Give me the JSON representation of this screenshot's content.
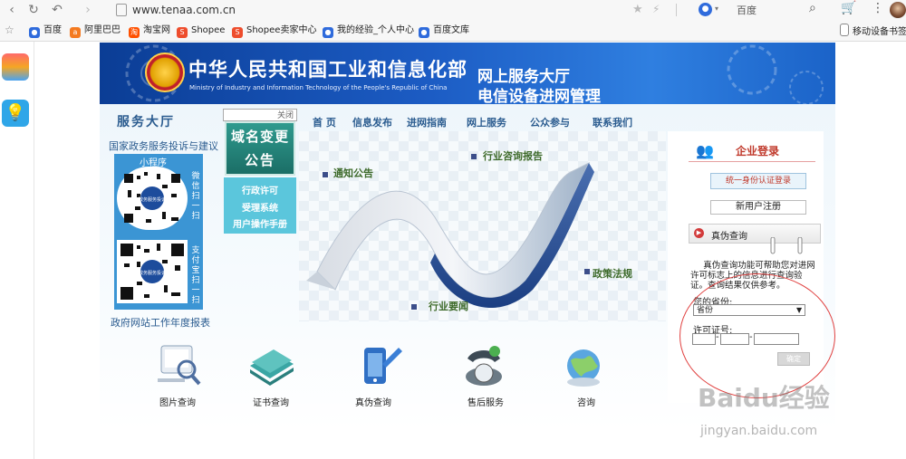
{
  "browser": {
    "url": "www.tenaa.com.cn",
    "search_engine_label": "百度",
    "bookmarks": [
      "百度",
      "阿里巴巴",
      "淘宝网",
      "Shopee",
      "Shopee卖家中心",
      "我的经验_个人中心",
      "百度文库"
    ],
    "bookmark_right": "移动设备书签"
  },
  "banner": {
    "title_cn": "中华人民共和国工业和信息化部",
    "title_en": "Ministry of Industry and Information Technology of the People's Republic of China",
    "right_line1": "网上服务大厅",
    "right_line2": "电信设备进网管理"
  },
  "left": {
    "service_hall": "服务大厅",
    "gov_service": "国家政务服务投诉与建议",
    "mini_program": "小程序",
    "wechat_side": "微信扫一扫",
    "alipay_side": "支付宝扫一扫",
    "qr_center_text": "政务服务投诉",
    "annual_report": "政府网站工作年度报表"
  },
  "popup": {
    "close_label": "关闭",
    "notice_line1": "域名变更",
    "notice_line2": "公告",
    "links": [
      "行政许可",
      "受理系统",
      "用户操作手册"
    ]
  },
  "nav": [
    "首 页",
    "信息发布",
    "进网指南",
    "网上服务",
    "公众参与",
    "联系我们"
  ],
  "graphic_labels": [
    "通知公告",
    "行业咨询报告",
    "政策法规",
    "行业要闻"
  ],
  "login": {
    "title": "企业登录",
    "sso_button": "统一身份认证登录",
    "register_button": "新用户注册"
  },
  "verify": {
    "title": "真伪查询",
    "description": "真伪查询功能可帮助您对进网许可标志上的信息进行查询验证。查询结果仅供参考。",
    "province_label": "您的省份:",
    "province_selected": "省份",
    "license_label": "许可证号:",
    "confirm_button": "确定"
  },
  "bottom_services": [
    "图片查询",
    "证书查询",
    "真伪查询",
    "售后服务",
    "咨询"
  ],
  "watermark": {
    "line1": "Baidu经验",
    "line2": "jingyan.baidu.com"
  },
  "colors": {
    "banner_blue": "#1c5cc4",
    "nav_text": "#2a5b8f",
    "login_red": "#c0392b",
    "annotation_red": "#e0403f",
    "qr_panel_blue": "#3b95d4",
    "menu_cyan": "#5bc6dc"
  }
}
